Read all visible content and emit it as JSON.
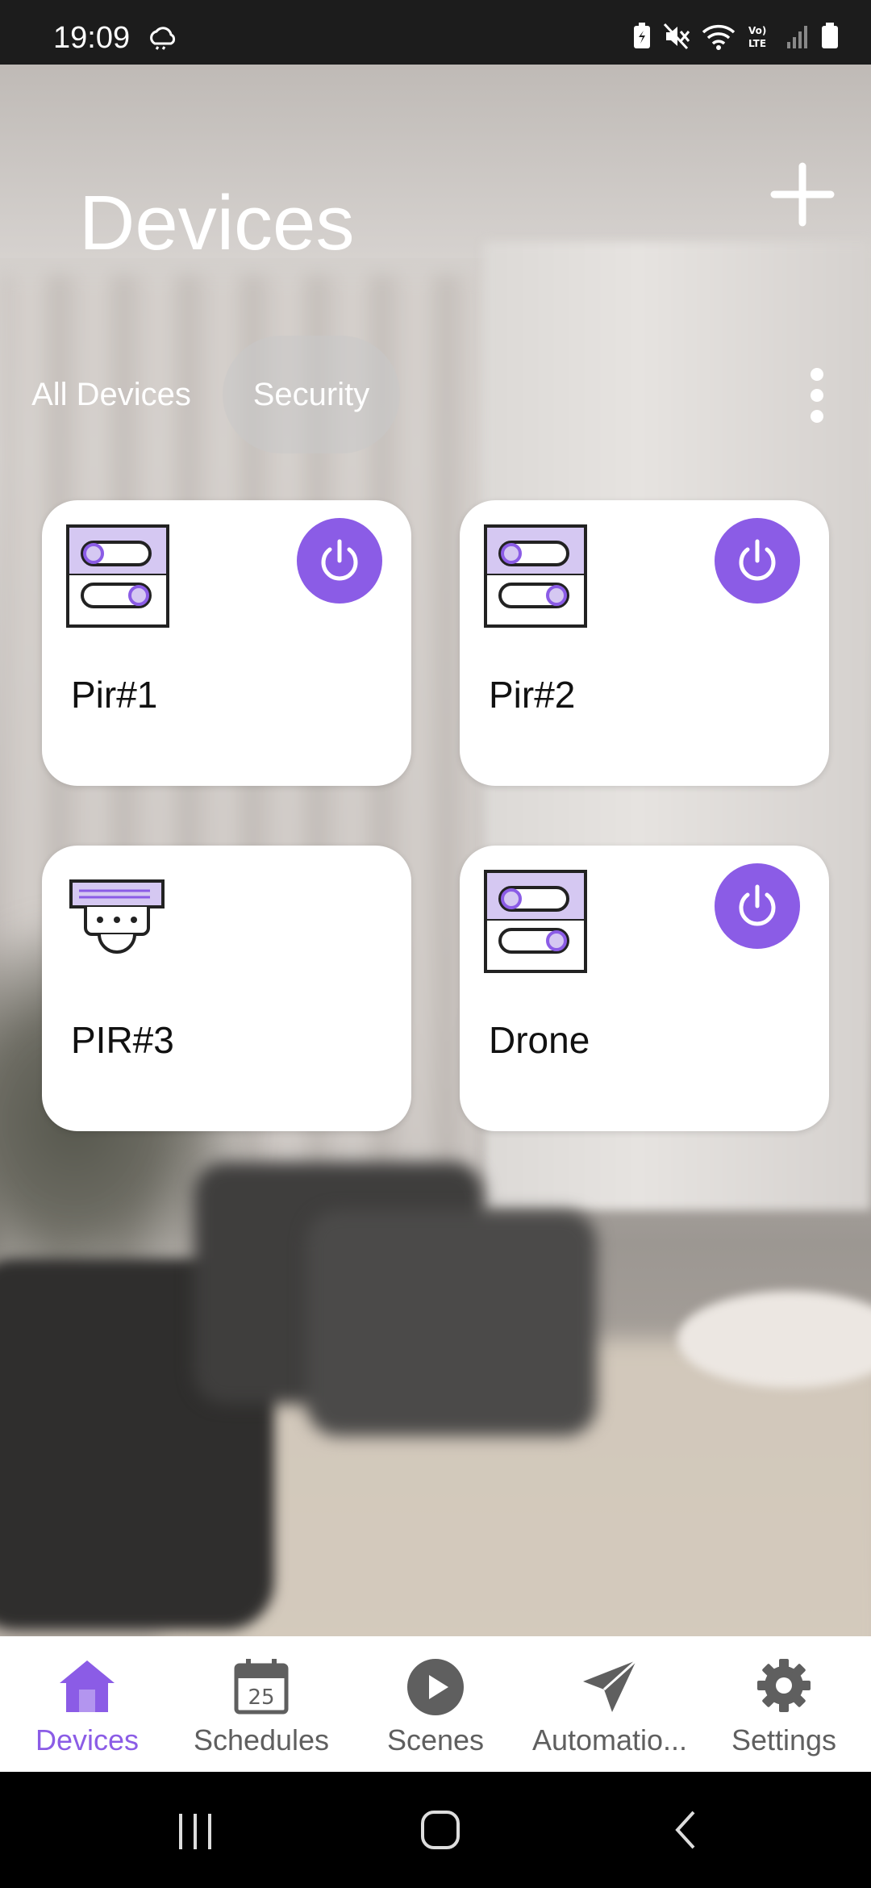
{
  "status_bar": {
    "time": "19:09",
    "icons": [
      "weather-cloud-icon",
      "battery-saver-icon",
      "mute-icon",
      "wifi-icon",
      "volte-icon",
      "signal-icon",
      "battery-icon"
    ]
  },
  "header": {
    "title": "Devices",
    "add_icon": "plus-icon",
    "more_icon": "kebab-icon"
  },
  "tabs": [
    {
      "label": "All Devices",
      "selected": false
    },
    {
      "label": "Security",
      "selected": true
    }
  ],
  "devices": [
    {
      "name": "Pir#1",
      "icon": "switch-panel-icon",
      "power": true
    },
    {
      "name": "Pir#2",
      "icon": "switch-panel-icon",
      "power": true
    },
    {
      "name": "PIR#3",
      "icon": "motion-sensor-icon",
      "power": false
    },
    {
      "name": "Drone",
      "icon": "switch-panel-icon",
      "power": true
    }
  ],
  "bottom_nav": [
    {
      "label": "Devices",
      "icon": "home-icon",
      "active": true
    },
    {
      "label": "Schedules",
      "icon": "calendar-icon",
      "active": false,
      "badge": "25"
    },
    {
      "label": "Scenes",
      "icon": "play-icon",
      "active": false
    },
    {
      "label": "Automatio...",
      "icon": "send-icon",
      "active": false
    },
    {
      "label": "Settings",
      "icon": "gear-icon",
      "active": false
    }
  ],
  "colors": {
    "accent": "#8b5ce6",
    "accent_light": "#d5c8f2",
    "card_bg": "#ffffff",
    "nav_inactive": "#5f5f5f"
  }
}
